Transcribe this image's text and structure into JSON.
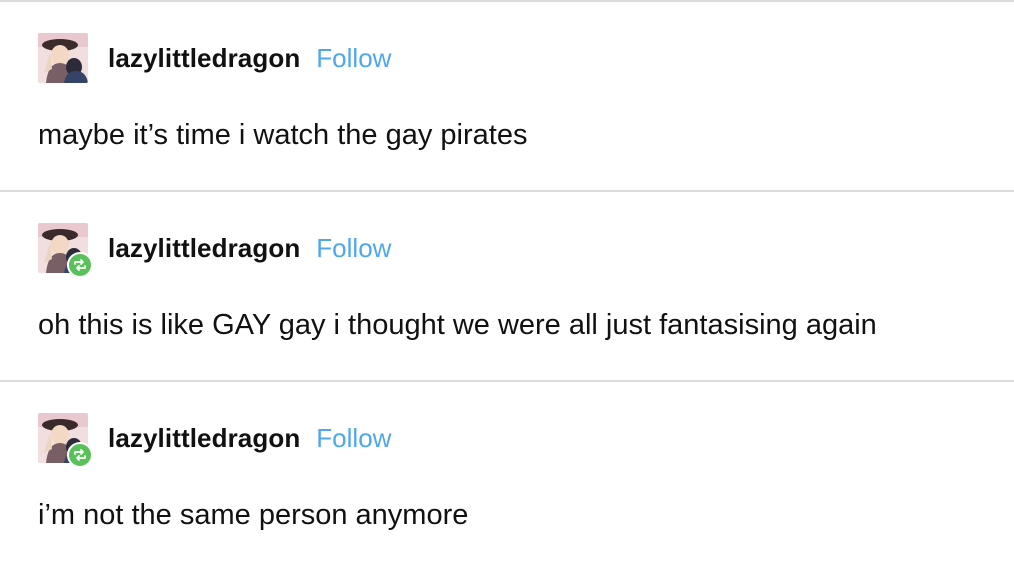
{
  "posts": [
    {
      "username": "lazylittledragon",
      "follow_label": "Follow",
      "text": "maybe it’s time i watch the gay pirates",
      "reblog": false,
      "avatar_icon": "avatar-image"
    },
    {
      "username": "lazylittledragon",
      "follow_label": "Follow",
      "text": "oh this is like GAY gay i thought we were all just fantasising again",
      "reblog": true,
      "avatar_icon": "avatar-image",
      "badge_icon": "reblog-icon"
    },
    {
      "username": "lazylittledragon",
      "follow_label": "Follow",
      "text": "i’m not the same person anymore",
      "reblog": true,
      "avatar_icon": "avatar-image",
      "badge_icon": "reblog-icon"
    }
  ],
  "colors": {
    "follow": "#4fa8ec",
    "reblog_badge": "#5ac05a",
    "divider": "#dcdcdc",
    "text": "#111111"
  }
}
